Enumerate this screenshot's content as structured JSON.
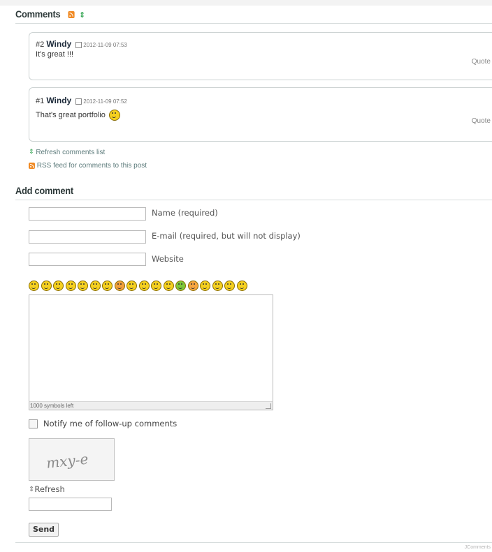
{
  "comments_section": {
    "title": "Comments",
    "comments": [
      {
        "number": "#2",
        "author": "Windy",
        "date": "2012-11-09 07:53",
        "text": "It's great !!!",
        "has_smiley": false,
        "quote_label": "Quote"
      },
      {
        "number": "#1",
        "author": "Windy",
        "date": "2012-11-09 07:52",
        "text": "That's great portfolio",
        "has_smiley": true,
        "quote_label": "Quote"
      }
    ],
    "refresh_link": "Refresh comments list",
    "rss_link": "RSS feed for comments to this post"
  },
  "add_comment": {
    "title": "Add comment",
    "name_label": "Name (required)",
    "name_value": "",
    "email_label": "E-mail (required, but will not display)",
    "email_value": "",
    "website_label": "Website",
    "website_value": "",
    "smileys": [
      "laugh",
      "grin",
      "smile",
      "wink",
      "cool",
      "smile",
      "confused",
      "shocked",
      "sad",
      "worried",
      "sleepy",
      "surprised",
      "sick",
      "angry",
      "asleep",
      "tongue",
      "happy",
      "wondering"
    ],
    "comment_value": "",
    "symbols_left": "1000 symbols left",
    "notify_label": "Notify me of follow-up comments",
    "notify_checked": false,
    "captcha_text": "mxy-e",
    "captcha_refresh": "Refresh",
    "captcha_value": "",
    "send_label": "Send"
  },
  "footer": {
    "credit": "JComments"
  },
  "colors": {
    "rss": "#f08a24",
    "refresh": "#2aa04a",
    "title": "#2e3a3a",
    "smiley": "#f5d020"
  }
}
